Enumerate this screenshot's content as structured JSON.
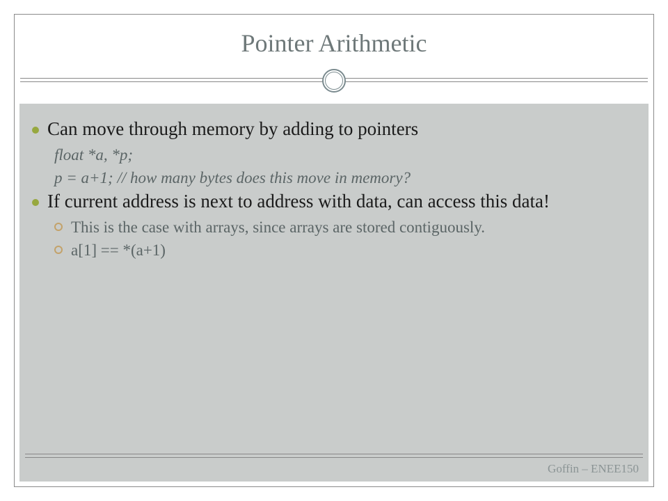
{
  "title": "Pointer Arithmetic",
  "bullets": [
    {
      "text": "Can move through memory by adding to pointers",
      "subs": [
        {
          "type": "code",
          "text": "float *a, *p;"
        },
        {
          "type": "code",
          "text": "p = a+1;  // how many bytes does this move in memory?"
        }
      ]
    },
    {
      "text": "If current address is next to address with data, can access this data!",
      "subs": [
        {
          "type": "circle",
          "text": "This is the case with arrays, since arrays are stored contiguously."
        },
        {
          "type": "circle",
          "text": "a[1] == *(a+1)"
        }
      ]
    }
  ],
  "footer": "Goffin – ENEE150"
}
